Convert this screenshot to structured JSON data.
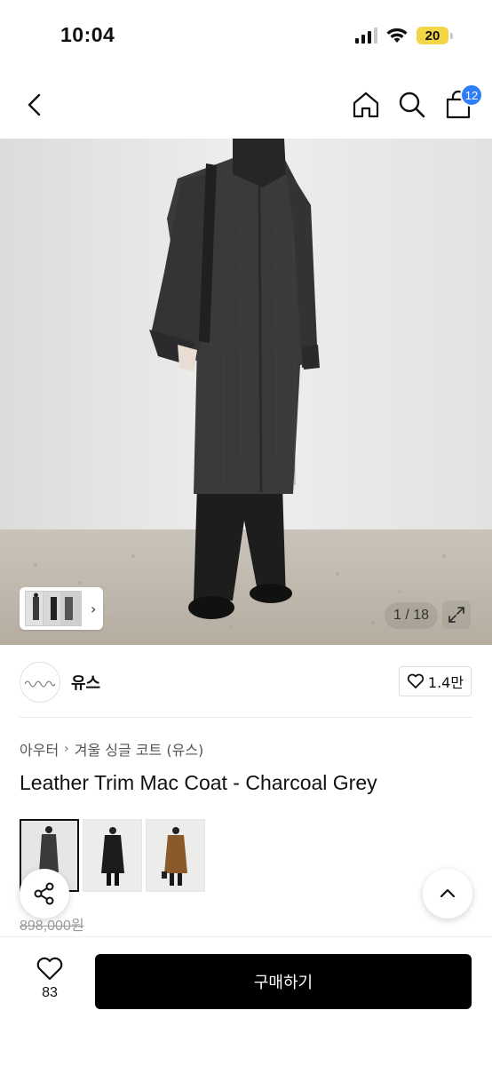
{
  "status": {
    "time": "10:04",
    "battery": "20"
  },
  "nav": {
    "cart_count": "12"
  },
  "gallery": {
    "counter": "1 / 18"
  },
  "brand": {
    "name": "유스",
    "likes": "1.4만"
  },
  "breadcrumb": {
    "items": [
      "아우터",
      "겨울 싱글 코트 (유스)"
    ]
  },
  "product": {
    "title": "Leather Trim Mac Coat - Charcoal Grey",
    "original_price": "898,000원",
    "variant_colors": [
      "#3b3b3c",
      "#1c1c1c",
      "#8a5a2b"
    ]
  },
  "bottom": {
    "wish_count": "83",
    "buy_label": "구매하기"
  },
  "colors": {
    "badge": "#2f7df7",
    "battery": "#f3d548",
    "buy_button": "#000000"
  }
}
